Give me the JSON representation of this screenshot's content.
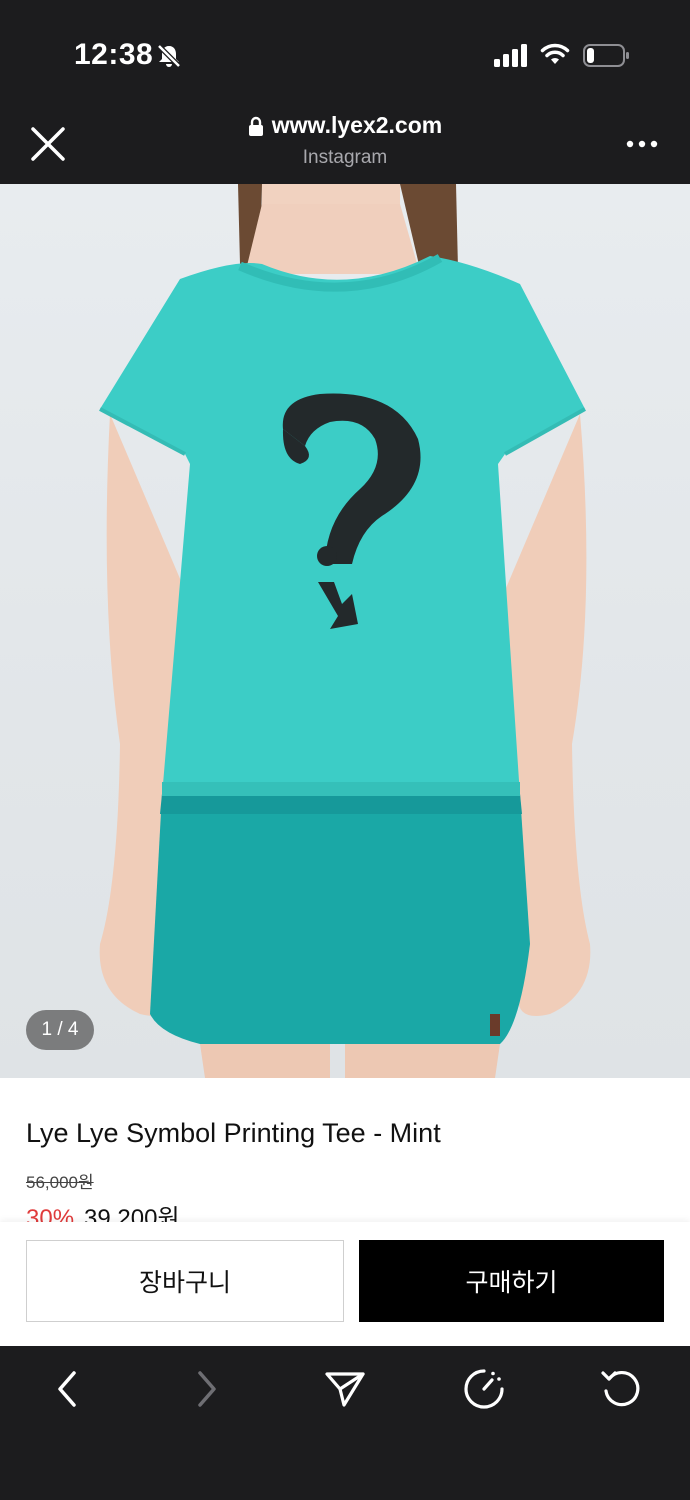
{
  "status_bar": {
    "time": "12:38",
    "icons": [
      "bell-slash-icon",
      "cellular-signal-icon",
      "wifi-icon",
      "battery-low-icon"
    ]
  },
  "browser": {
    "url": "www.lyex2.com",
    "source": "Instagram",
    "close_icon": "close-icon",
    "more_icon": "more-dots-icon"
  },
  "gallery": {
    "counter": "1 / 4"
  },
  "product": {
    "title": "Lye Lye Symbol Printing Tee - Mint",
    "original_price": "56,000원",
    "discount": "30%",
    "sale_price": "39,200원"
  },
  "actions": {
    "cart_label": "장바구니",
    "buy_label": "구매하기"
  },
  "bottom_nav": {
    "items": [
      "back-icon",
      "forward-icon",
      "share-icon",
      "speed-icon",
      "refresh-icon"
    ]
  },
  "colors": {
    "shirt": "#3ccdc6",
    "skirt": "#1aa8a6",
    "discount": "#e03b3b",
    "chrome": "#1c1c1e"
  }
}
